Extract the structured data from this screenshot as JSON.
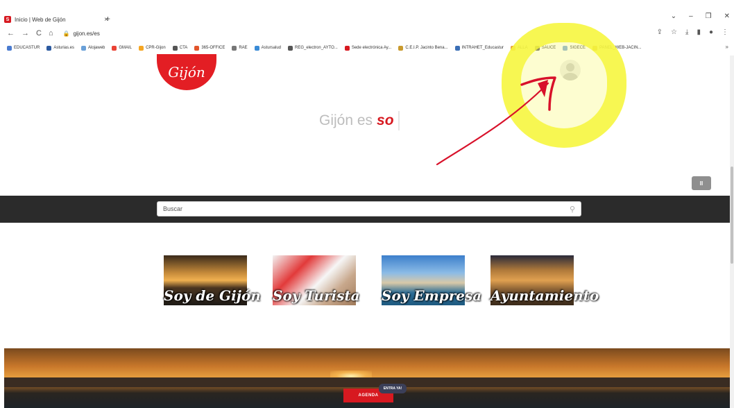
{
  "browser": {
    "tab_title": "Inicio | Web de Gijón",
    "tab_favicon": "S",
    "tab_close": "×",
    "new_tab": "+",
    "url": "gijon.es/es",
    "nav_back": "←",
    "nav_forward": "→",
    "nav_reload": "C",
    "nav_home": "⌂",
    "bookmarks": [
      {
        "label": "EDUCASTUR",
        "color": "#4a7bd0"
      },
      {
        "label": "Asturias.es",
        "color": "#2c5aa0"
      },
      {
        "label": "Alojaweb",
        "color": "#6aa0d8"
      },
      {
        "label": "GMAIL",
        "color": "#ea4335"
      },
      {
        "label": "CPR-Gijon",
        "color": "#f5a623"
      },
      {
        "label": "CTA",
        "color": "#555555"
      },
      {
        "label": "365-OFFICE",
        "color": "#e2552b"
      },
      {
        "label": "RAE",
        "color": "#777777"
      },
      {
        "label": "Astursalud",
        "color": "#3a8bd6"
      },
      {
        "label": "REG_electron_AYTO...",
        "color": "#555555"
      },
      {
        "label": "Sede electrónica Ay...",
        "color": "#d71920"
      },
      {
        "label": "C.E.I.P. Jacinto Bena...",
        "color": "#c99a2e"
      },
      {
        "label": "INTRAHET_Educastur",
        "color": "#3b6fb6"
      },
      {
        "label": "ALLA",
        "color": "#e8a33a"
      },
      {
        "label": "SAUCE",
        "color": "#555555"
      },
      {
        "label": "SIGECE",
        "color": "#7aa7d8"
      },
      {
        "label": "PANEL_WEB-JACIN...",
        "color": "#c99a2e"
      }
    ],
    "bookmarks_more": "»"
  },
  "page": {
    "logo_text": "Gijón",
    "slogan_main": "Gijón es",
    "slogan_accent": "so",
    "pause_label": "II",
    "search_placeholder": "Buscar",
    "cards": [
      {
        "label": "Soy de Gijón"
      },
      {
        "label": "Soy Turista"
      },
      {
        "label": "Soy Empresa"
      },
      {
        "label": "Ayuntamiento"
      }
    ],
    "agenda_label": "AGENDA",
    "entra_label": "ENTRA YA!"
  },
  "colors": {
    "brand_red": "#d71920",
    "search_band": "#2b2b2b",
    "highlight": "#f6f63c",
    "arrow": "#d8112a"
  }
}
